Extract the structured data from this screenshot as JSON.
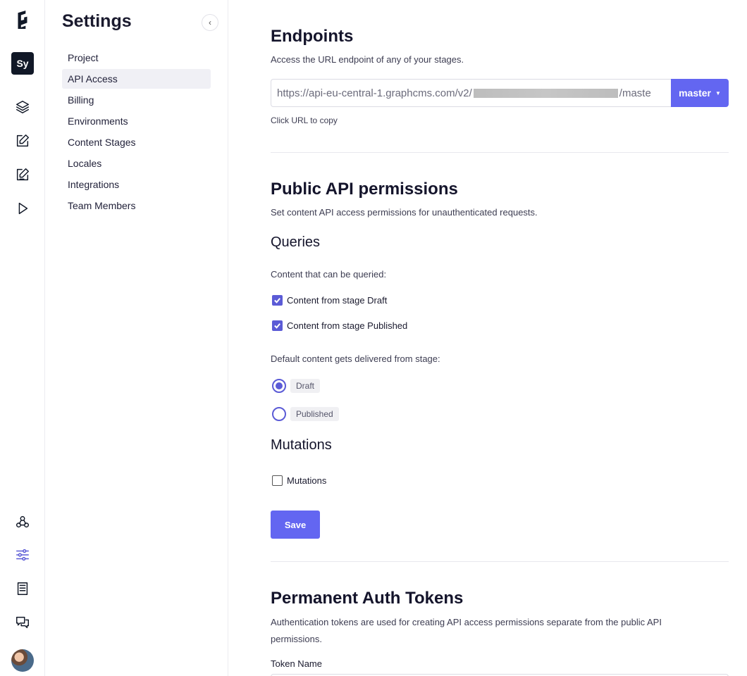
{
  "rail": {
    "project_badge": "Sy",
    "icons": [
      "graphcms-logo-icon",
      "layers-icon",
      "edit-icon",
      "edit-alt-icon",
      "play-icon",
      "webhook-icon",
      "sliders-icon",
      "book-icon",
      "chat-icon"
    ],
    "active_color": "#5b5bd6"
  },
  "sidebar": {
    "title": "Settings",
    "collapse_label": "‹",
    "items": [
      {
        "label": "Project"
      },
      {
        "label": "API Access"
      },
      {
        "label": "Billing"
      },
      {
        "label": "Environments"
      },
      {
        "label": "Content Stages"
      },
      {
        "label": "Locales"
      },
      {
        "label": "Integrations"
      },
      {
        "label": "Team Members"
      }
    ],
    "active_index": 1
  },
  "endpoints": {
    "title": "Endpoints",
    "description": "Access the URL endpoint of any of your stages.",
    "url_prefix": "https://api-eu-central-1.graphcms.com/v2/",
    "url_suffix": "/maste",
    "environment": "master",
    "hint": "Click URL to copy"
  },
  "public_api": {
    "title": "Public API permissions",
    "description": "Set content API access permissions for unauthenticated requests.",
    "queries_title": "Queries",
    "queries_label": "Content that can be queried:",
    "query_options": [
      {
        "label": "Content from stage Draft",
        "checked": true
      },
      {
        "label": "Content from stage Published",
        "checked": true
      }
    ],
    "default_stage_label": "Default content gets delivered from stage:",
    "stage_options": [
      {
        "label": "Draft",
        "selected": true
      },
      {
        "label": "Published",
        "selected": false
      }
    ],
    "mutations_title": "Mutations",
    "mutations_option": {
      "label": "Mutations",
      "checked": false
    },
    "save_label": "Save"
  },
  "auth_tokens": {
    "title": "Permanent Auth Tokens",
    "description": "Authentication tokens are used for creating API access permissions separate from the public API permissions.",
    "token_name_label": "Token Name"
  },
  "colors": {
    "accent": "#6366f1",
    "check": "#5b5bd6"
  }
}
